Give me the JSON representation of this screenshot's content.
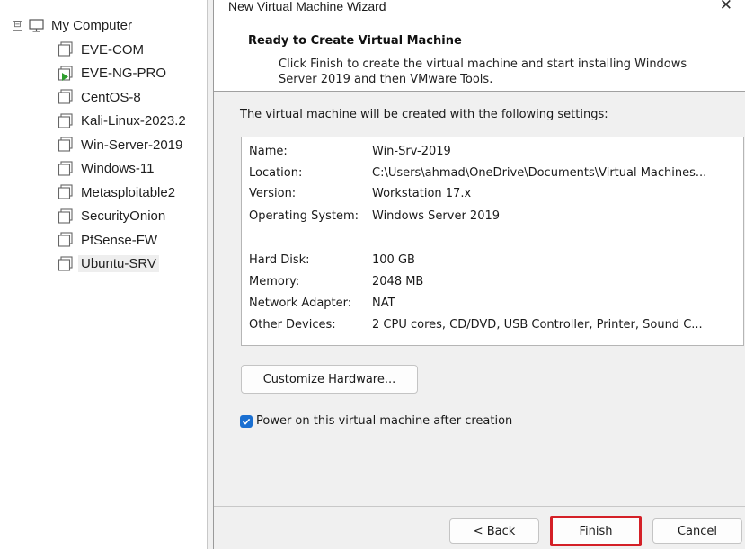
{
  "tree": {
    "root_label": "My Computer",
    "root_expander": "⊟",
    "items": [
      {
        "label": "EVE-COM",
        "running": false
      },
      {
        "label": "EVE-NG-PRO",
        "running": true
      },
      {
        "label": "CentOS-8",
        "running": false
      },
      {
        "label": "Kali-Linux-2023.2",
        "running": false
      },
      {
        "label": "Win-Server-2019",
        "running": false
      },
      {
        "label": "Windows-11",
        "running": false
      },
      {
        "label": "Metasploitable2",
        "running": false
      },
      {
        "label": "SecurityOnion",
        "running": false
      },
      {
        "label": "PfSense-FW",
        "running": false
      },
      {
        "label": "Ubuntu-SRV",
        "running": false,
        "selected": true
      }
    ]
  },
  "dialog": {
    "title": "New Virtual Machine Wizard",
    "close_glyph": "✕",
    "header_title": "Ready to Create Virtual Machine",
    "header_desc": "Click Finish to create the virtual machine and start installing Windows Server 2019 and then VMware Tools.",
    "intro": "The virtual machine will be created with the following settings:",
    "summary": [
      {
        "key": "Name:",
        "value": "Win-Srv-2019"
      },
      {
        "key": "Location:",
        "value": "C:\\Users\\ahmad\\OneDrive\\Documents\\Virtual Machines..."
      },
      {
        "key": "Version:",
        "value": "Workstation 17.x"
      },
      {
        "key": "Operating System:",
        "value": "Windows Server 2019"
      },
      {
        "key": "Hard Disk:",
        "value": "100 GB"
      },
      {
        "key": "Memory:",
        "value": "2048 MB"
      },
      {
        "key": "Network Adapter:",
        "value": "NAT"
      },
      {
        "key": "Other Devices:",
        "value": "2 CPU cores, CD/DVD, USB Controller, Printer, Sound C..."
      }
    ],
    "customize_label": "Customize Hardware...",
    "power_on_label": "Power on this virtual machine after creation",
    "power_on_checked": true,
    "back_label": "< Back",
    "finish_label": "Finish",
    "cancel_label": "Cancel"
  },
  "colors": {
    "accent": "#1a6fd1",
    "highlight_border": "#d42027",
    "run_indicator": "#2e9e2e"
  }
}
